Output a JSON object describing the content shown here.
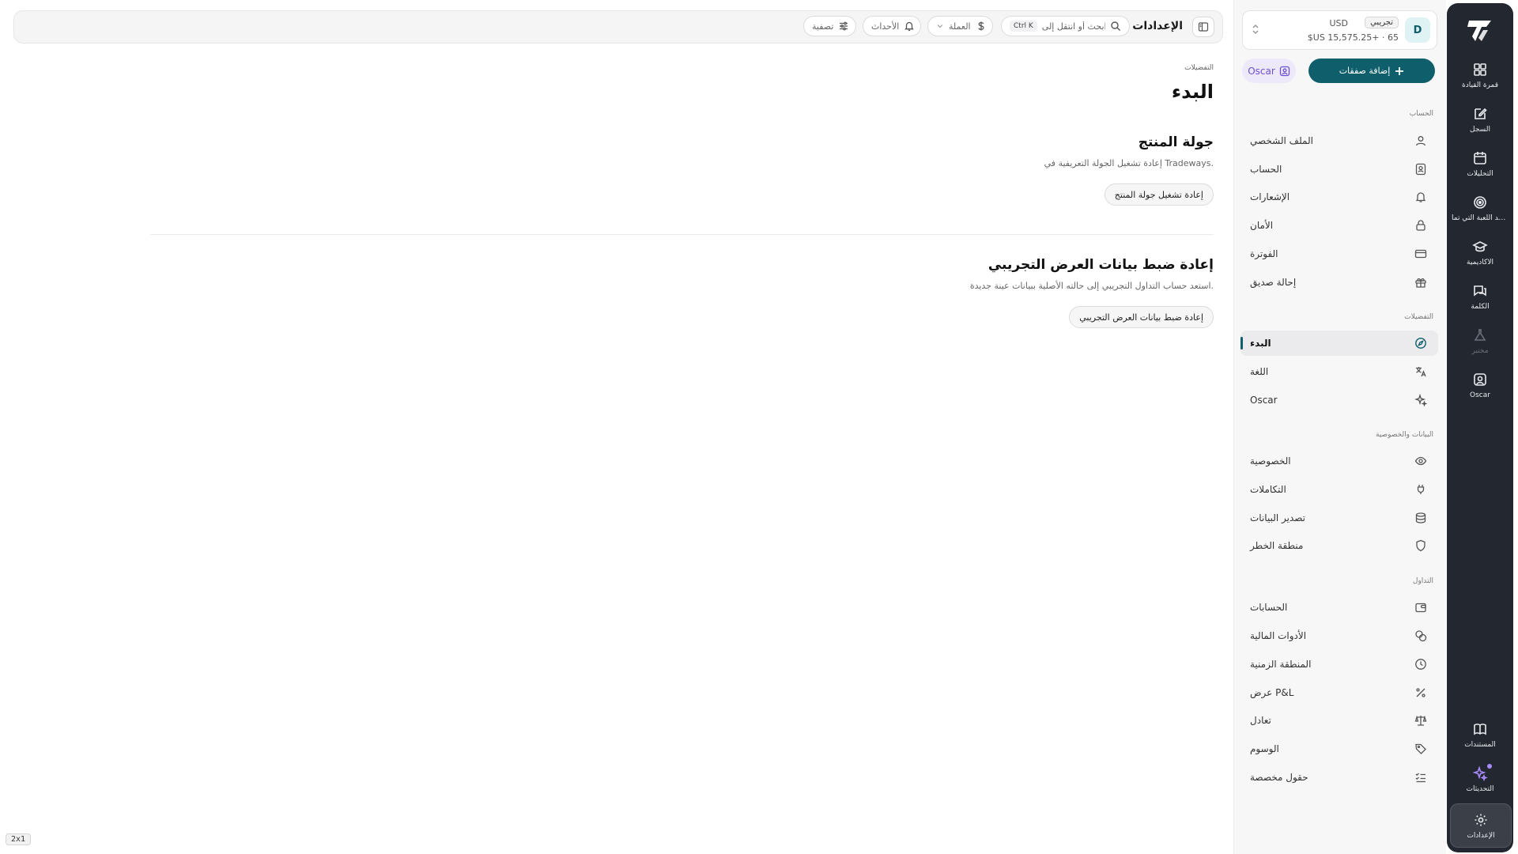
{
  "rail": {
    "items": [
      {
        "label": "قمرة القيادة",
        "icon": "grid-icon"
      },
      {
        "label": "السجل",
        "icon": "edit-icon"
      },
      {
        "label": "التحليلات",
        "icon": "calendar-icon"
      },
      {
        "label": "قواعد اللعبة التي تما...",
        "icon": "target-icon"
      },
      {
        "label": "الأكاديمية",
        "icon": "graduation-icon"
      },
      {
        "label": "الكلمة",
        "icon": "chat-icon"
      },
      {
        "label": "مختبر",
        "icon": "flask-icon"
      },
      {
        "label": "Oscar",
        "icon": "oscar-icon"
      }
    ],
    "bottom": [
      {
        "label": "المستندات",
        "icon": "book-icon"
      },
      {
        "label": "التحديثات",
        "icon": "sparkles-icon"
      },
      {
        "label": "الإعدادات",
        "icon": "gear-icon"
      }
    ]
  },
  "account": {
    "avatar": "D",
    "badge": "تجريبي",
    "currency": "USD",
    "balance": "$US 15,575.25+ · 65"
  },
  "actions": {
    "add_trades": "إضافة صفقات",
    "oscar": "Oscar"
  },
  "sidebar": {
    "sections": [
      {
        "title": "الحساب"
      },
      {
        "title": "التفضيلات"
      },
      {
        "title": "البيانات والخصوصية"
      },
      {
        "title": "التداول"
      }
    ],
    "account_items": [
      {
        "label": "الملف الشخصي",
        "icon": "user-icon"
      },
      {
        "label": "الحساب",
        "icon": "id-card-icon"
      },
      {
        "label": "الإشعارات",
        "icon": "bell-icon"
      },
      {
        "label": "الأمان",
        "icon": "lock-icon"
      },
      {
        "label": "الفوترة",
        "icon": "credit-card-icon"
      },
      {
        "label": "إحالة صديق",
        "icon": "gift-icon"
      }
    ],
    "pref_items": [
      {
        "label": "البدء",
        "icon": "compass-icon"
      },
      {
        "label": "اللغة",
        "icon": "translate-icon"
      },
      {
        "label": "Oscar",
        "icon": "sparkle-icon"
      }
    ],
    "data_items": [
      {
        "label": "الخصوصية",
        "icon": "eye-icon"
      },
      {
        "label": "التكاملات",
        "icon": "plug-icon"
      },
      {
        "label": "تصدير البيانات",
        "icon": "database-icon"
      },
      {
        "label": "منطقة الخطر",
        "icon": "shield-icon"
      }
    ],
    "trading_items": [
      {
        "label": "الحسابات",
        "icon": "wallet-icon"
      },
      {
        "label": "الأدوات المالية",
        "icon": "coins-icon"
      },
      {
        "label": "المنطقة الزمنية",
        "icon": "clock-icon"
      },
      {
        "label": "عرض P&L",
        "icon": "percent-icon"
      },
      {
        "label": "تعادل",
        "icon": "scale-icon"
      },
      {
        "label": "الوسوم",
        "icon": "tag-icon"
      },
      {
        "label": "حقول مخصصة",
        "icon": "checklist-icon"
      }
    ]
  },
  "toolbar": {
    "title": "الإعدادات",
    "search_placeholder": "ابحث أو انتقل إلى...",
    "search_shortcut": "Ctrl K",
    "currency": "العملة",
    "events": "الأحداث",
    "filter": "تصفية"
  },
  "main": {
    "breadcrumb": "التفضيلات",
    "title": "البدء",
    "tour": {
      "title": "جولة المنتج",
      "description": "إعادة تشغيل الجولة التعريفية في Tradeways.",
      "button": "إعادة تشغيل جولة المنتج"
    },
    "reset": {
      "title": "إعادة ضبط بيانات العرض التجريبي",
      "description": "استعد حساب التداول التجريبي إلى حالته الأصلية ببيانات عينة جديدة.",
      "button": "إعادة ضبط بيانات العرض التجريبي"
    }
  },
  "zoom": "2x1",
  "colors": {
    "accent": "#0e5e6b",
    "rail_bg": "#23272f",
    "oscar": "#6d4fd1"
  }
}
